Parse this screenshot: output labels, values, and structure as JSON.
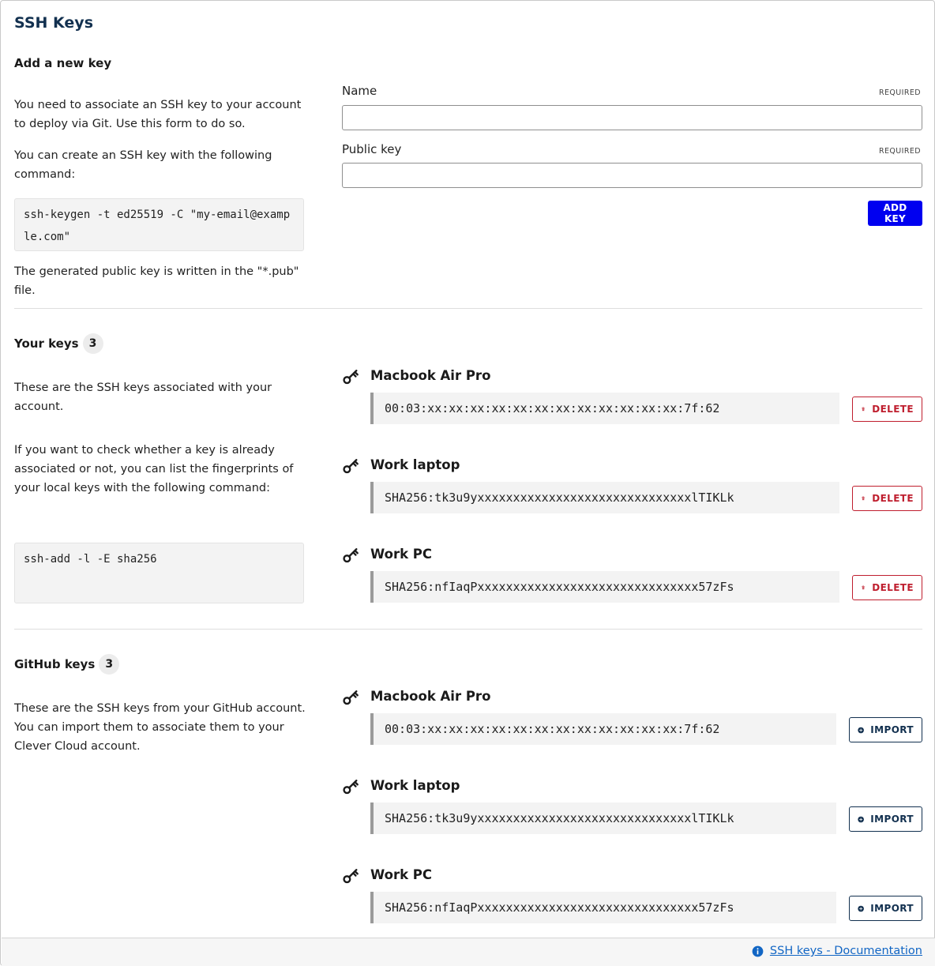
{
  "page": {
    "title": "SSH Keys"
  },
  "add_key": {
    "heading": "Add a new key",
    "description_1": "You need to associate an SSH key to your account to deploy via Git. Use this form to do so.",
    "description_2": "You can create an SSH key with the following command:",
    "command": "ssh-keygen -t ed25519 -C \"my-email@example.com\"",
    "description_3": "The generated public key is written in the \"*.pub\" file.",
    "name_label": "Name",
    "name_required": "REQUIRED",
    "name_value": "",
    "public_key_label": "Public key",
    "public_key_required": "REQUIRED",
    "public_key_value": "",
    "submit_label": "ADD KEY"
  },
  "your_keys": {
    "heading": "Your keys",
    "count": "3",
    "description_1": "These are the SSH keys associated with your account.",
    "description_2": "If you want to check whether a key is already associated or not, you can list the fingerprints of your local keys with the following command:",
    "command": "ssh-add -l -E sha256",
    "action_label": "DELETE",
    "keys": [
      {
        "name": "Macbook Air Pro",
        "fingerprint": "00:03:xx:xx:xx:xx:xx:xx:xx:xx:xx:xx:xx:xx:7f:62"
      },
      {
        "name": "Work laptop",
        "fingerprint": "SHA256:tk3u9yxxxxxxxxxxxxxxxxxxxxxxxxxxxxxxlTIKLk"
      },
      {
        "name": "Work PC",
        "fingerprint": "SHA256:nfIaqPxxxxxxxxxxxxxxxxxxxxxxxxxxxxxxx57zFs"
      }
    ]
  },
  "github_keys": {
    "heading": "GitHub keys",
    "count": "3",
    "description_1": "These are the SSH keys from your GitHub account. You can import them to associate them to your Clever Cloud account.",
    "action_label": "IMPORT",
    "keys": [
      {
        "name": "Macbook Air Pro",
        "fingerprint": "00:03:xx:xx:xx:xx:xx:xx:xx:xx:xx:xx:xx:xx:7f:62"
      },
      {
        "name": "Work laptop",
        "fingerprint": "SHA256:tk3u9yxxxxxxxxxxxxxxxxxxxxxxxxxxxxxxlTIKLk"
      },
      {
        "name": "Work PC",
        "fingerprint": "SHA256:nfIaqPxxxxxxxxxxxxxxxxxxxxxxxxxxxxxxx57zFs"
      }
    ]
  },
  "footer": {
    "doc_link_label": "SSH keys - Documentation"
  },
  "colors": {
    "primary": "#0000f0",
    "danger": "#bf1e2e",
    "title": "#12304f",
    "link": "#1266c4"
  },
  "icons": {
    "key": "key-icon",
    "delete": "trash-icon",
    "import": "plus-circle-icon",
    "info": "info-icon"
  }
}
